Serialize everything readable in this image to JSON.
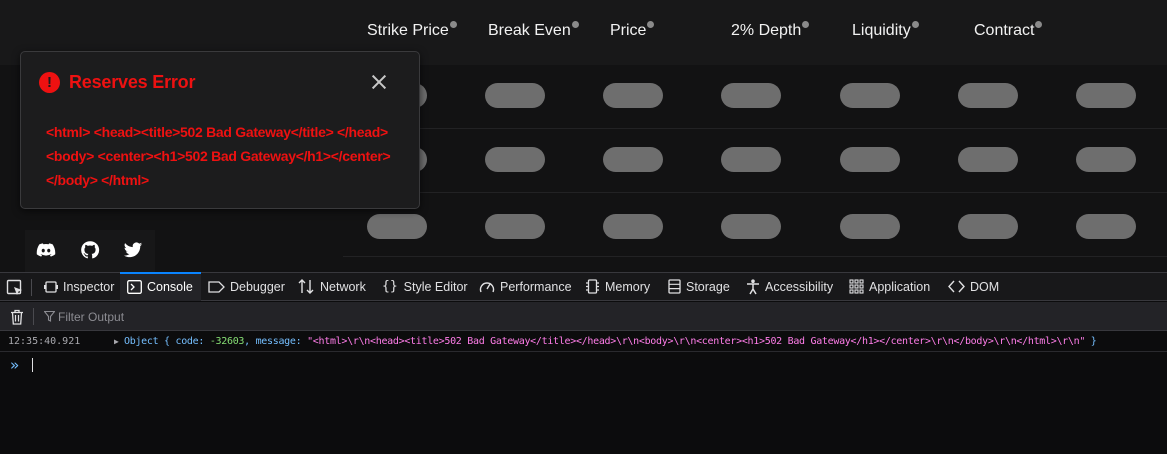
{
  "table": {
    "columns": [
      "Strike Price",
      "Break Even",
      "Price",
      "2% Depth",
      "Liquidity",
      "Contract"
    ],
    "rows": 3
  },
  "error": {
    "title": "Reserves Error",
    "icon": "!",
    "body": "<html> <head><title>502 Bad Gateway</title> </head> <body> <center><h1>502 Bad Gateway</h1></center> </body> </html>"
  },
  "social": [
    "discord-icon",
    "github-icon",
    "twitter-icon"
  ],
  "devtools": {
    "tabs": [
      {
        "label": "Inspector",
        "icon": "inspector-icon"
      },
      {
        "label": "Console",
        "icon": "console-icon",
        "active": true
      },
      {
        "label": "Debugger",
        "icon": "debugger-icon"
      },
      {
        "label": "Network",
        "icon": "network-icon"
      },
      {
        "label": "Style Editor",
        "icon": "style-editor-icon"
      },
      {
        "label": "Performance",
        "icon": "performance-icon"
      },
      {
        "label": "Memory",
        "icon": "memory-icon"
      },
      {
        "label": "Storage",
        "icon": "storage-icon"
      },
      {
        "label": "Accessibility",
        "icon": "accessibility-icon"
      },
      {
        "label": "Application",
        "icon": "application-icon"
      },
      {
        "label": "DOM",
        "icon": "dom-icon"
      }
    ],
    "filter_placeholder": "Filter Output",
    "log": {
      "timestamp": "12:35:40.921",
      "prefix": "Object { code: ",
      "code": "-32603",
      "mid": ", message: ",
      "message": "\"<html>\\r\\n<head><title>502 Bad Gateway</title></head>\\r\\n<body>\\r\\n<center><h1>502 Bad Gateway</h1></center>\\r\\n</body>\\r\\n</html>\\r\\n\"",
      "suffix": " }"
    },
    "prompt": "»"
  },
  "colors": {
    "error_red": "#ee1111",
    "accent_blue": "#0a84ff",
    "placeholder_pill": "#6e6e6e"
  }
}
